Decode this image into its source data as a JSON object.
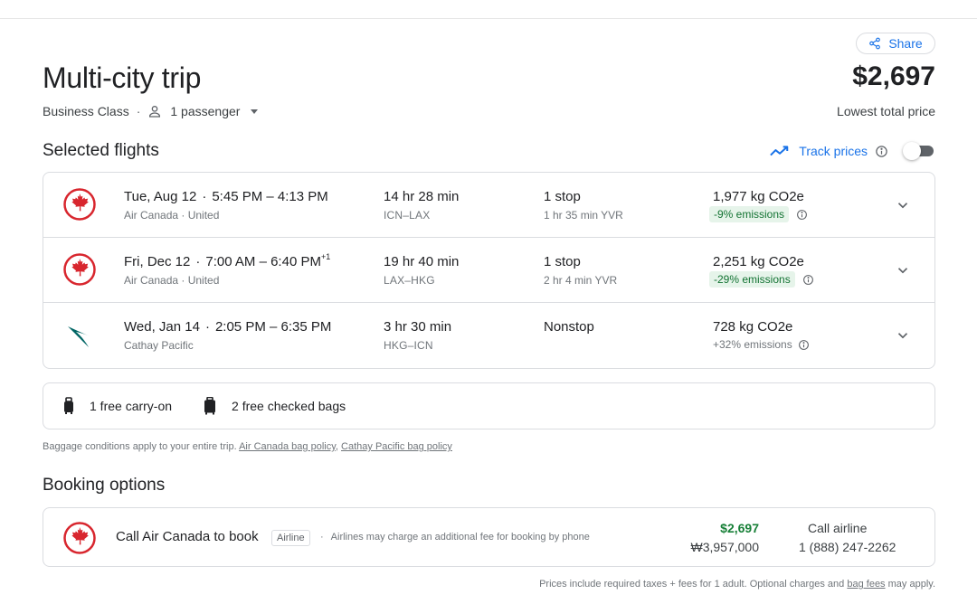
{
  "header": {
    "share_label": "Share",
    "title": "Multi-city trip",
    "cabin": "Business Class",
    "separator": "·",
    "passengers": "1 passenger",
    "total_price": "$2,697",
    "price_caption": "Lowest total price"
  },
  "selected": {
    "section_title": "Selected flights",
    "track_label": "Track prices",
    "track_enabled": false,
    "flights": [
      {
        "date": "Tue, Aug 12",
        "time_sep": "·",
        "depart": "5:45 PM",
        "dash": "–",
        "arrive": "4:13 PM",
        "day_offset": "",
        "airline": "Air Canada · United",
        "duration": "14 hr 28 min",
        "route": "ICN–LAX",
        "stops": "1 stop",
        "layover": "1 hr 35 min YVR",
        "co2": "1,977 kg CO2e",
        "emissions": "-9% emissions",
        "emissions_style": "green",
        "logo": "air-canada-maple-leaf"
      },
      {
        "date": "Fri, Dec 12",
        "time_sep": "·",
        "depart": "7:00 AM",
        "dash": "–",
        "arrive": "6:40 PM",
        "day_offset": "+1",
        "airline": "Air Canada · United",
        "duration": "19 hr 40 min",
        "route": "LAX–HKG",
        "stops": "1 stop",
        "layover": "2 hr 4 min YVR",
        "co2": "2,251 kg CO2e",
        "emissions": "-29% emissions",
        "emissions_style": "green",
        "logo": "air-canada-maple-leaf"
      },
      {
        "date": "Wed, Jan 14",
        "time_sep": "·",
        "depart": "2:05 PM",
        "dash": "–",
        "arrive": "6:35 PM",
        "day_offset": "",
        "airline": "Cathay Pacific",
        "duration": "3 hr 30 min",
        "route": "HKG–ICN",
        "stops": "Nonstop",
        "layover": "",
        "co2": "728 kg CO2e",
        "emissions": "+32% emissions",
        "emissions_style": "plain",
        "logo": "cathay-pacific-brushwing"
      }
    ]
  },
  "baggage": {
    "carry_on": "1 free carry-on",
    "checked": "2 free checked bags",
    "note_prefix": "Baggage conditions apply to your entire trip.",
    "link_air_canada": "Air Canada bag policy",
    "comma": ",",
    "link_cathay": "Cathay Pacific bag policy"
  },
  "booking": {
    "section_title": "Booking options",
    "option_title": "Call Air Canada to book",
    "tag": "Airline",
    "separator": "·",
    "note": "Airlines may charge an additional fee for booking by phone",
    "price_usd": "$2,697",
    "price_krw": "₩3,957,000",
    "call_label": "Call airline",
    "phone": "1 (888) 247-2262"
  },
  "footer": {
    "text": "Prices include required taxes + fees for 1 adult. Optional charges and",
    "link": "bag fees",
    "suffix": "may apply."
  },
  "colors": {
    "accent": "#1a73e8",
    "air_canada_red": "#d8262e",
    "cathay_teal": "#006564",
    "green_text": "#188038",
    "green_badge_bg": "#e6f4ea"
  }
}
